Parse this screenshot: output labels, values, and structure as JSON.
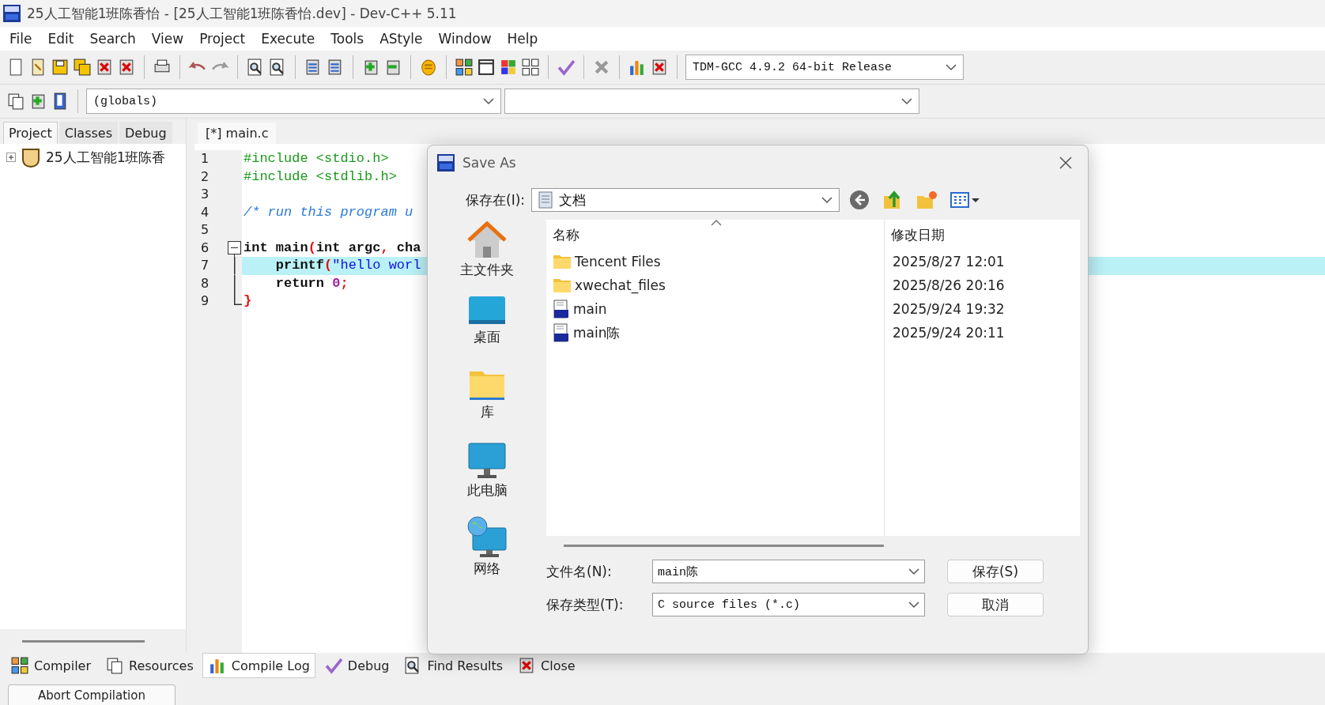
{
  "window": {
    "title": "25人工智能1班陈香怡 - [25人工智能1班陈香怡.dev] - Dev-C++ 5.11"
  },
  "menu": [
    "File",
    "Edit",
    "Search",
    "View",
    "Project",
    "Execute",
    "Tools",
    "AStyle",
    "Window",
    "Help"
  ],
  "compiler_select": {
    "value": "TDM-GCC 4.9.2 64-bit Release"
  },
  "scope_select": {
    "value": "(globals)"
  },
  "side_tabs": [
    {
      "label": "Project",
      "selected": true
    },
    {
      "label": "Classes",
      "selected": false
    },
    {
      "label": "Debug",
      "selected": false
    }
  ],
  "project_tree": [
    {
      "label": "25人工智能1班陈香",
      "expanded": false
    }
  ],
  "editor_tabs": [
    {
      "label": "[*] main.c",
      "selected": true
    }
  ],
  "code_lines": [
    {
      "number": "1",
      "highlighted": false,
      "tokens": [
        {
          "kind": "preprocessor",
          "text": "#include <stdio.h>"
        }
      ]
    },
    {
      "number": "2",
      "highlighted": false,
      "tokens": [
        {
          "kind": "preprocessor",
          "text": "#include <stdlib.h>"
        }
      ]
    },
    {
      "number": "3",
      "highlighted": false
    },
    {
      "number": "4",
      "highlighted": false,
      "tokens": [
        {
          "kind": "comment",
          "text": "/* run this program u"
        }
      ]
    },
    {
      "number": "5",
      "highlighted": false
    },
    {
      "number": "6",
      "highlighted": false,
      "fold_start": true,
      "tokens": [
        {
          "kind": "plain",
          "text": "int main"
        },
        {
          "kind": "symbol",
          "text": "("
        },
        {
          "kind": "plain",
          "text": "int argc"
        },
        {
          "kind": "symbol",
          "text": ","
        },
        {
          "kind": "plain",
          "text": " cha"
        }
      ]
    },
    {
      "number": "7",
      "highlighted": true,
      "fold_body": true,
      "tokens": [
        {
          "kind": "plain",
          "text": "    printf"
        },
        {
          "kind": "symbol",
          "text": "("
        },
        {
          "kind": "string",
          "text": "\"hello worl"
        }
      ]
    },
    {
      "number": "8",
      "highlighted": false,
      "fold_body": true,
      "tokens": [
        {
          "kind": "plain",
          "text": "    return "
        },
        {
          "kind": "number",
          "text": "0"
        },
        {
          "kind": "symbol",
          "text": ";"
        }
      ]
    },
    {
      "number": "9",
      "highlighted": false,
      "fold_end": true,
      "tokens": [
        {
          "kind": "symbol",
          "text": "}"
        }
      ]
    }
  ],
  "dialog": {
    "title": "Save As",
    "location_label": "保存在(I):",
    "location": "文档",
    "places": [
      {
        "kind": "home",
        "label": "主文件夹"
      },
      {
        "kind": "desktop",
        "label": "桌面"
      },
      {
        "kind": "library",
        "label": "库"
      },
      {
        "kind": "computer",
        "label": "此电脑"
      },
      {
        "kind": "network",
        "label": "网络"
      }
    ],
    "columns": [
      "名称",
      "修改日期"
    ],
    "files": [
      {
        "kind": "folder",
        "name": "Tencent Files",
        "modified": "2025/8/27 12:01"
      },
      {
        "kind": "folder",
        "name": "xwechat_files",
        "modified": "2025/8/26 20:16"
      },
      {
        "kind": "file",
        "name": "main",
        "modified": "2025/9/24 19:32"
      },
      {
        "kind": "file",
        "name": "main陈",
        "modified": "2025/9/24 20:11"
      }
    ],
    "filename_label": "文件名(N):",
    "filename": "main陈",
    "filetype_label": "保存类型(T):",
    "filetype": "C source files (*.c)",
    "buttons": [
      "保存(S)",
      "取消"
    ]
  },
  "bottom_tabs": [
    {
      "label": "Compiler",
      "selected": false
    },
    {
      "label": "Resources",
      "selected": false
    },
    {
      "label": "Compile Log",
      "selected": true
    },
    {
      "label": "Debug",
      "selected": false
    },
    {
      "label": "Find Results",
      "selected": false
    },
    {
      "label": "Close",
      "selected": false
    }
  ],
  "abort_button": "Abort Compilation"
}
